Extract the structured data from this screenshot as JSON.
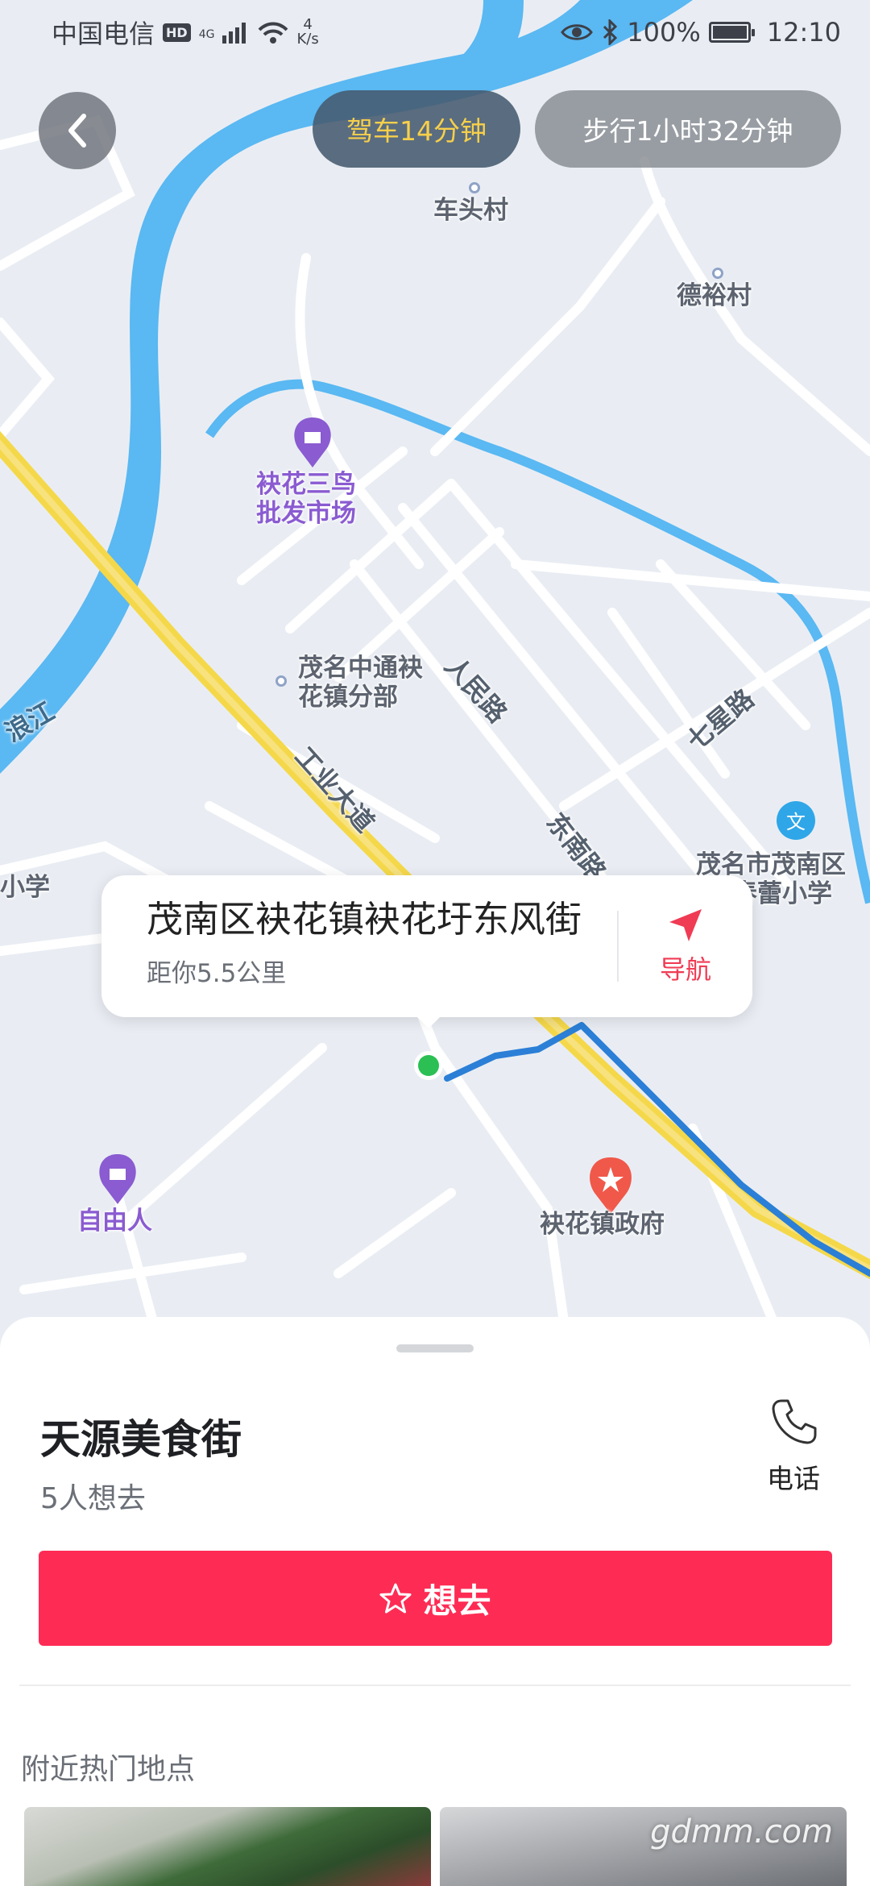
{
  "status_bar": {
    "carrier": "中国电信",
    "hd": "HD",
    "network": "4G",
    "speed_value": "4",
    "speed_unit": "K/s",
    "battery": "100%",
    "time": "12:10"
  },
  "route_tabs": {
    "drive": "驾车14分钟",
    "walk": "步行1小时32分钟",
    "drive_color": "#f6cf4b"
  },
  "map": {
    "labels": {
      "chetou": "车头村",
      "deyu": "德裕村",
      "market_line1": "袂花三鸟",
      "market_line2": "批发市场",
      "zhongtong_line1": "茂名中通袂",
      "zhongtong_line2": "花镇分部",
      "renmin_road": "人民路",
      "qixing_road": "七星路",
      "gongye_road": "工业大道",
      "dongnan_road": "东南路",
      "school_line1": "茂名市茂南区",
      "school_line2": "镇春蕾小学",
      "xiaoxue_left": "小学",
      "river_left": "浪江",
      "ziyouren": "自由人",
      "government": "袂花镇政府"
    },
    "route_color": "#2b7fd6",
    "river_color": "#5ab8f2",
    "highway_color": "#f5d84a"
  },
  "location_card": {
    "address": "茂南区袂花镇袂花圩东风街",
    "distance": "距你5.5公里",
    "nav_label": "导航"
  },
  "sheet": {
    "place_name": "天源美食街",
    "want_count": "5人想去",
    "phone_label": "电话",
    "want_button": "想去",
    "nearby_title": "附近热门地点",
    "accent_color": "#fe2c55"
  },
  "watermark": "gdmm.com"
}
